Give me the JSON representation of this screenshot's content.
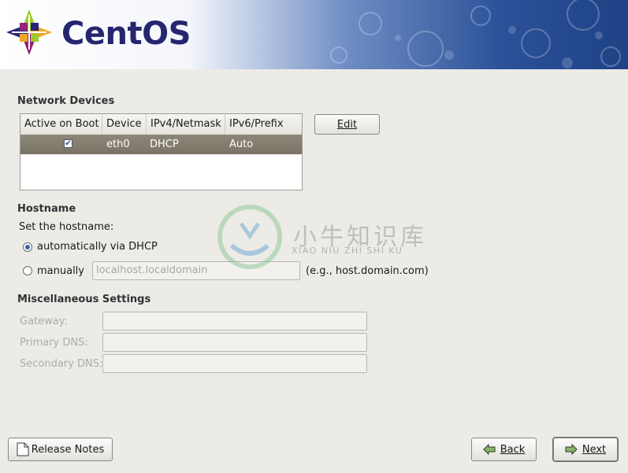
{
  "header": {
    "brand": "CentOS"
  },
  "network_devices": {
    "title": "Network Devices",
    "columns": [
      "Active on Boot",
      "Device",
      "IPv4/Netmask",
      "IPv6/Prefix"
    ],
    "rows": [
      {
        "active": true,
        "device": "eth0",
        "ipv4": "DHCP",
        "ipv6": "Auto"
      }
    ],
    "edit_button": "Edit"
  },
  "hostname": {
    "title": "Hostname",
    "prompt": "Set the hostname:",
    "option_auto": "automatically via DHCP",
    "option_manual": "manually",
    "selected": "auto",
    "manual_value": "localhost.localdomain",
    "manual_hint": "(e.g., host.domain.com)"
  },
  "misc": {
    "title": "Miscellaneous Settings",
    "gateway_label": "Gateway:",
    "primary_dns_label": "Primary DNS:",
    "secondary_dns_label": "Secondary DNS:",
    "gateway_value": "",
    "primary_dns_value": "",
    "secondary_dns_value": ""
  },
  "footer": {
    "release_notes": "Release Notes",
    "back": "Back",
    "next": "Next"
  },
  "watermark": {
    "chinese": "小牛知识库",
    "pinyin": "XIAO NIU ZHI SHI KU"
  },
  "colors": {
    "banner_dark": "#1f4286",
    "brand_text": "#25266f",
    "selected_row": "#7a7467",
    "window_bg": "#edebe6"
  }
}
